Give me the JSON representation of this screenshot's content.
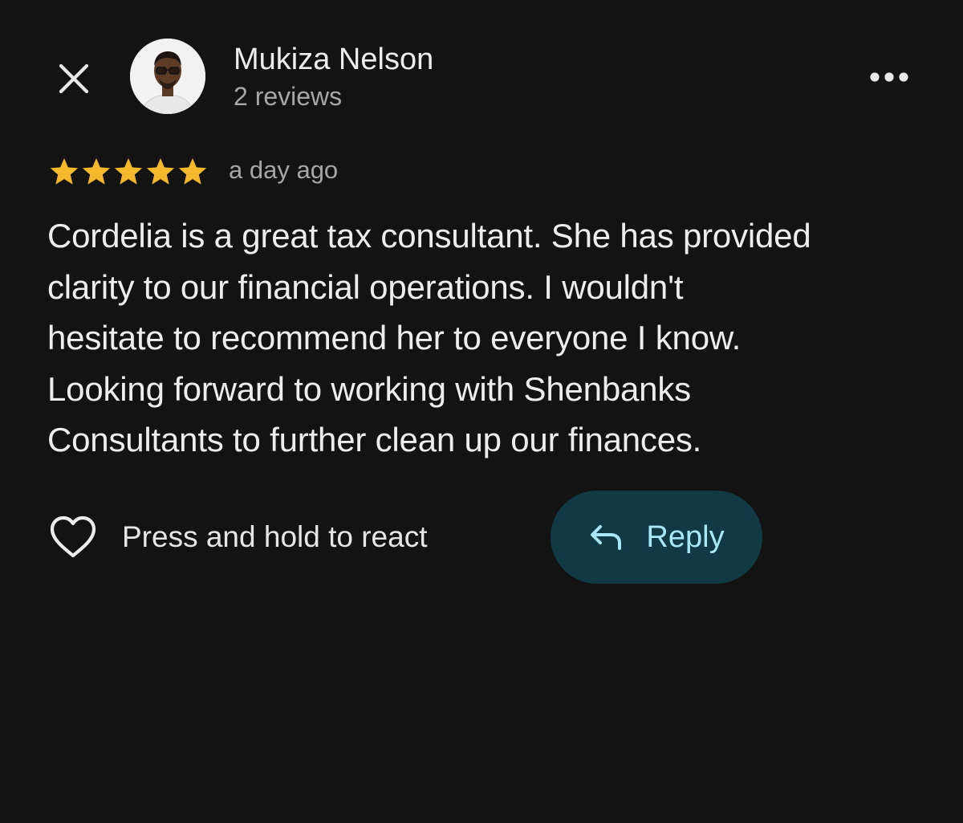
{
  "colors": {
    "background": "#131313",
    "star": "#f5b72b",
    "reply_bg": "#113a44",
    "reply_text": "#a9e6f6",
    "primary_text": "#ededed",
    "secondary_text": "#a6a6a6"
  },
  "header": {
    "close_icon": "close-icon",
    "author_name": "Mukiza Nelson",
    "author_meta": "2 reviews",
    "more_icon": "more-horizontal-icon"
  },
  "review": {
    "rating": 5,
    "rating_max": 5,
    "time_ago": "a day ago",
    "text_lines": [
      "Cordelia is a great tax consultant. She has provided",
      "clarity to our financial operations. I wouldn't",
      "hesitate to recommend her to everyone I know.",
      "Looking forward to working with Shenbanks",
      "Consultants to further clean up our finances."
    ]
  },
  "actions": {
    "react_icon": "heart-outline-icon",
    "react_label": "Press and hold to react",
    "reply_icon": "reply-arrow-icon",
    "reply_label": "Reply"
  }
}
